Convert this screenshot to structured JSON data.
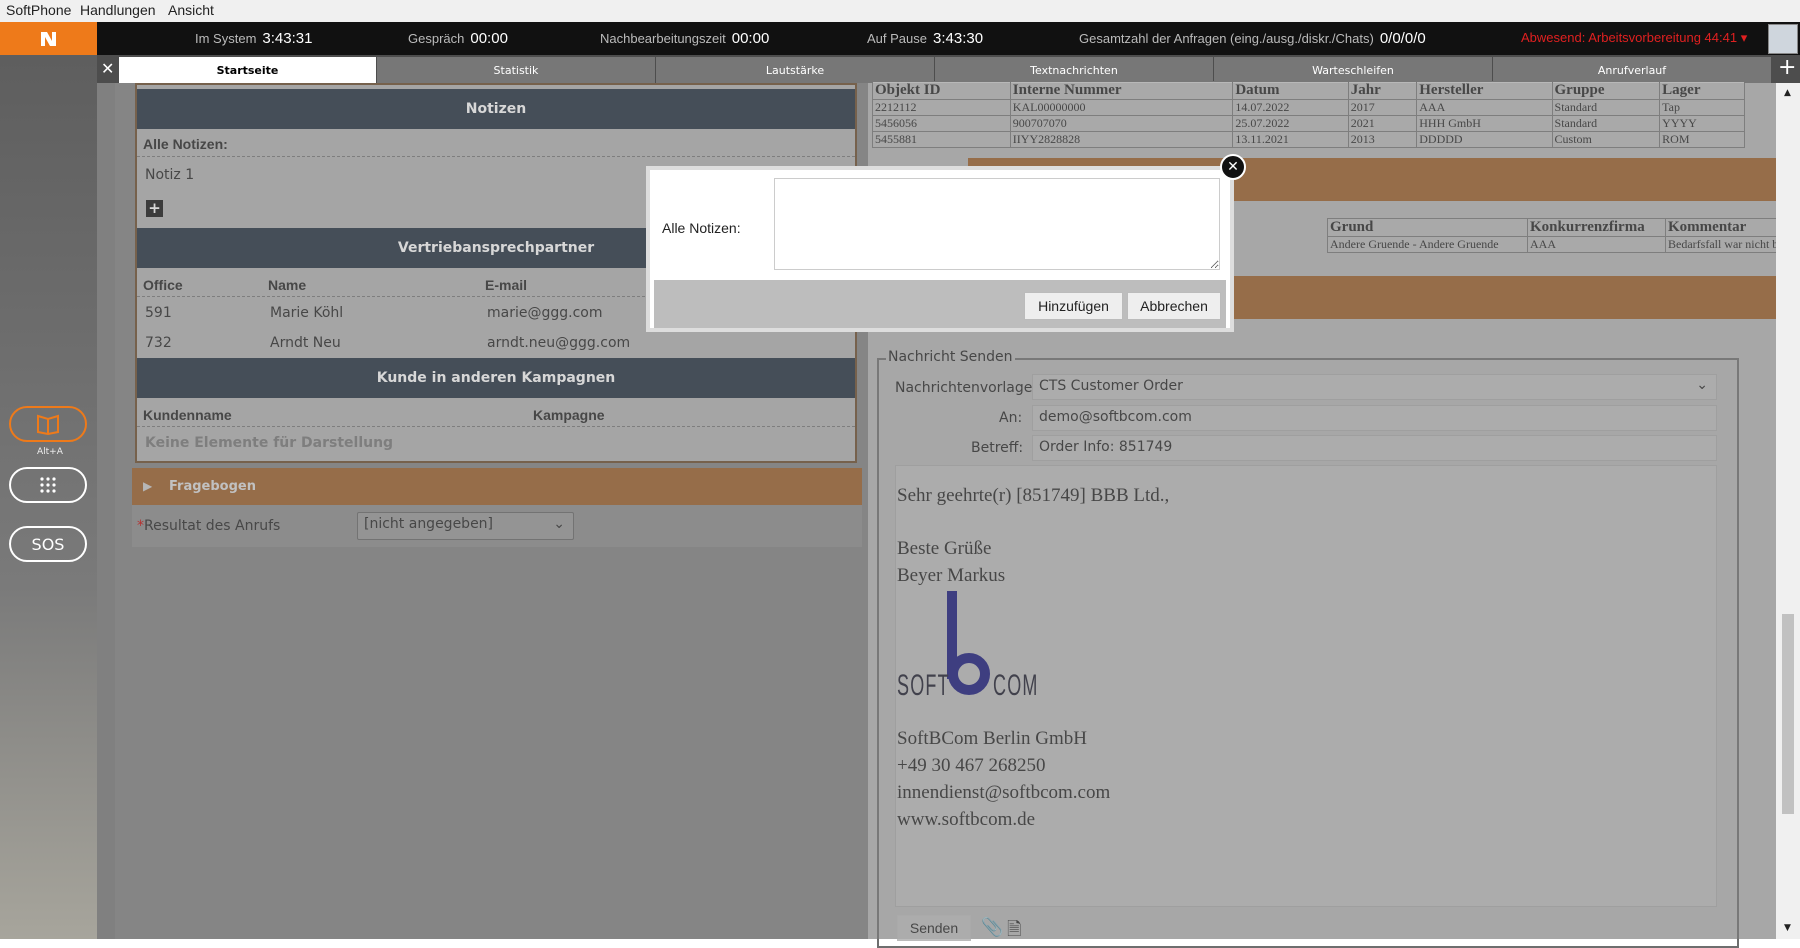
{
  "menu": {
    "items": [
      "SoftPhone",
      "Handlungen",
      "Ansicht"
    ]
  },
  "topbar": {
    "im_system_label": "Im System",
    "im_system_value": "3:43:31",
    "gespraech_label": "Gespräch",
    "gespraech_value": "00:00",
    "nachbearbeitung_label": "Nachbearbeitungszeit",
    "nachbearbeitung_value": "00:00",
    "pause_label": "Auf Pause",
    "pause_value": "3:43:30",
    "anfragen_label": "Gesamtzahl der Anfragen (eing./ausg./diskr./Chats)",
    "anfragen_value": "0/0/0/0",
    "status": "Abwesend: Arbeitsvorbereitung  44:41"
  },
  "sidebar": {
    "hotkey": "Alt+A",
    "sos": "SOS"
  },
  "tabs": [
    "Startseite",
    "Statistik",
    "Lautstärke",
    "Textnachrichten",
    "Warteschleifen",
    "Anrufverlauf"
  ],
  "notizen": {
    "title": "Notizen",
    "all_label": "Alle Notizen:",
    "item": "Notiz 1"
  },
  "vertrieb": {
    "title": "Vertriebansprechpartner",
    "cols": [
      "Office",
      "Name",
      "E-mail"
    ],
    "rows": [
      [
        "591",
        "Marie Köhl",
        "marie@ggg.com"
      ],
      [
        "732",
        "Arndt Neu",
        "arndt.neu@ggg.com"
      ]
    ]
  },
  "kampagnen": {
    "title": "Kunde in anderen Kampagnen",
    "cols": [
      "Kundenname",
      "Kampagne"
    ],
    "empty": "Keine Elemente für Darstellung"
  },
  "fragebogen": {
    "title": "Fragebogen"
  },
  "resultat": {
    "label": "Resultat des Anrufs",
    "value": "[nicht angegeben]"
  },
  "objekte": {
    "cols": [
      "Objekt ID",
      "Interne Nummer",
      "Datum",
      "Jahr",
      "Hersteller",
      "Gruppe",
      "Lager"
    ],
    "rows": [
      [
        "2212112",
        "KAL00000000",
        "14.07.2022",
        "2017",
        "AAA",
        "Standard",
        "Tap"
      ],
      [
        "5456056",
        "900707070",
        "25.07.2022",
        "2021",
        "HHH GmbH",
        "Standard",
        "YYYY"
      ],
      [
        "5455881",
        "IIYY2828828",
        "13.11.2021",
        "2013",
        "DDDDD",
        "Custom",
        "ROM"
      ]
    ]
  },
  "konkurrenz": {
    "cols": [
      "Grund",
      "Konkurrenzfirma",
      "Kommentar"
    ],
    "row": [
      "Andere Gruende - Andere Gruende",
      "AAA",
      "Bedarfsfall war nicht bekannt -"
    ]
  },
  "nachricht": {
    "legend": "Nachricht Senden",
    "vorlage_label": "Nachrichtenvorlage",
    "vorlage_value": "CTS Customer Order",
    "an_label": "An:",
    "an_value": "demo@softbcom.com",
    "betreff_label": "Betreff:",
    "betreff_value": "Order Info:  851749",
    "greeting": "Sehr geehrte(r) [851749] BBB Ltd.,",
    "closing": "Beste Grüße",
    "sender": "Beyer Markus",
    "logo_left": "SOFT",
    "logo_right": "COM",
    "company": "SoftBCom Berlin GmbH",
    "phone": "+49 30 467 268250",
    "email": "innendienst@softbcom.com",
    "web": "www.softbcom.de",
    "send": "Senden"
  },
  "dialog": {
    "label": "Alle Notizen:",
    "add": "Hinzufügen",
    "cancel": "Abbrechen"
  }
}
